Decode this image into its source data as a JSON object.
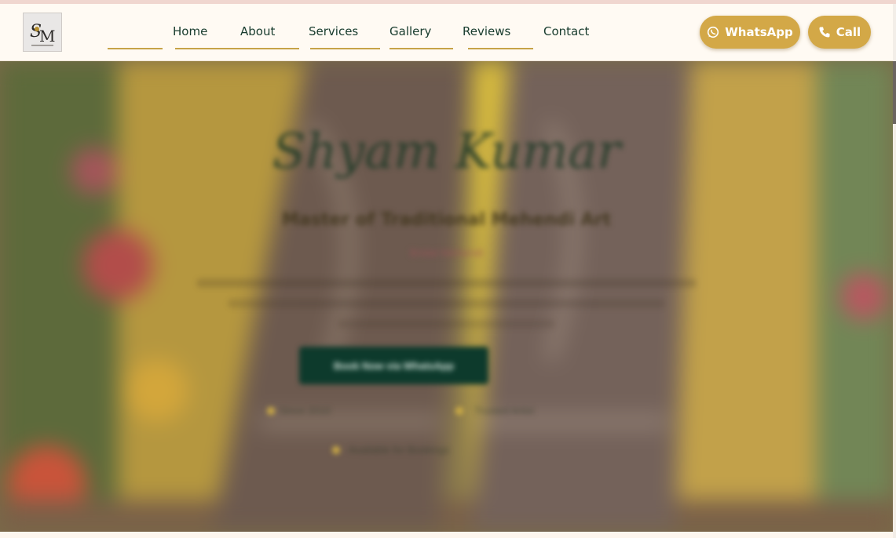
{
  "logo": {
    "letters": "SM",
    "icon": "sm-monogram-logo"
  },
  "nav": {
    "items": [
      {
        "label": "Home"
      },
      {
        "label": "About"
      },
      {
        "label": "Services"
      },
      {
        "label": "Gallery"
      },
      {
        "label": "Reviews"
      },
      {
        "label": "Contact"
      }
    ]
  },
  "header_buttons": {
    "whatsapp_label": "WhatsApp",
    "whatsapp_icon": "whatsapp-icon",
    "call_label": "Call",
    "call_icon": "phone-icon"
  },
  "hero": {
    "title": "Shyam Kumar",
    "subtitle": "Master of Traditional Mehendi Art",
    "tagline": "Bridal Mehendi",
    "cta_label": "Book Now via WhatsApp",
    "feature_1": "Since 2010",
    "feature_2": "Trusted Artist",
    "feature_3": "Available for Bookings"
  },
  "colors": {
    "accent_gold": "#d3a847",
    "dark_green": "#0d3a2c",
    "nav_text": "#173b2d"
  }
}
